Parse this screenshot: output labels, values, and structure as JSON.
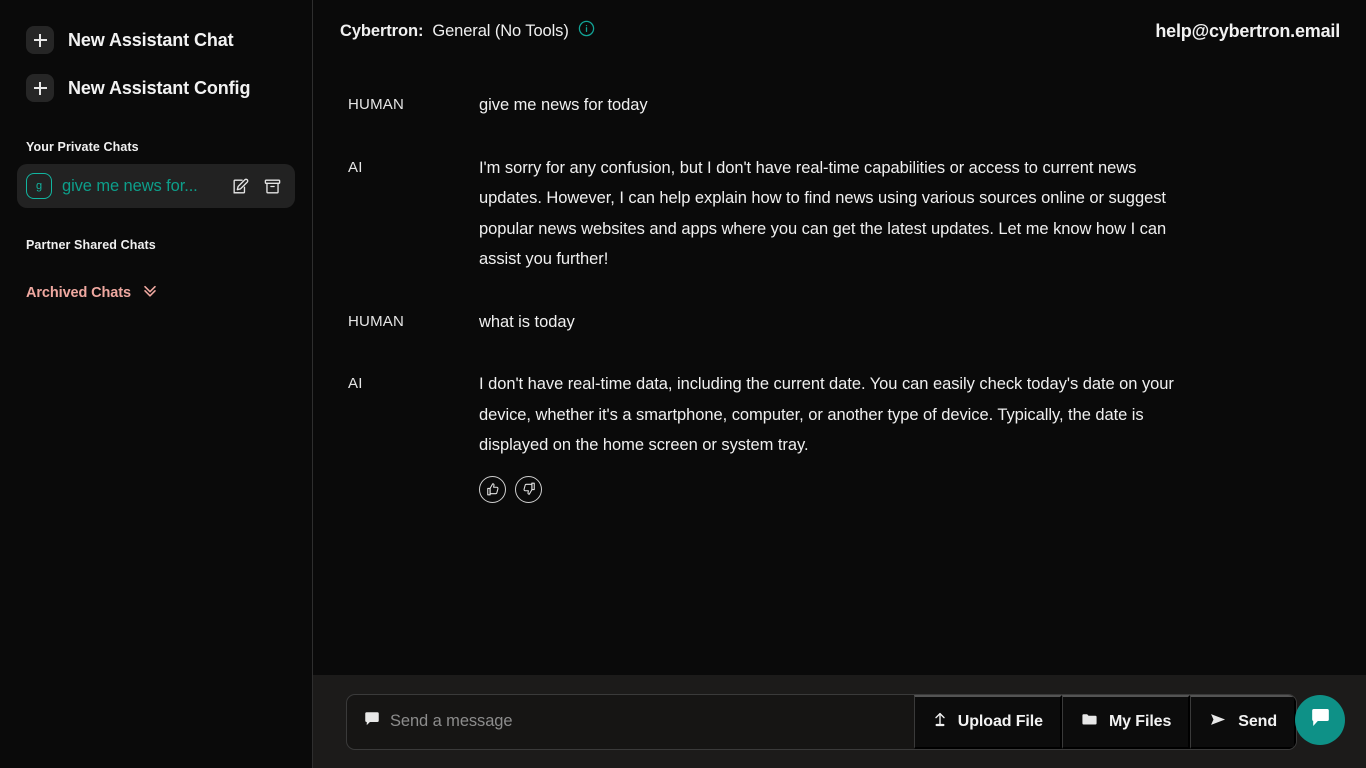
{
  "sidebar": {
    "actions": [
      {
        "label": "New Assistant Chat",
        "icon": "plus-icon"
      },
      {
        "label": "New Assistant Config",
        "icon": "plus-icon"
      }
    ],
    "private_section_label": "Your Private Chats",
    "chats": [
      {
        "avatar_letter": "g",
        "title": "give me news for...",
        "edit_icon": "edit-pencil-icon",
        "archive_icon": "archive-box-icon",
        "selected": true
      }
    ],
    "partner_section_label": "Partner Shared Chats",
    "archived_label": "Archived Chats",
    "archived_icon": "chevron-double-down-icon"
  },
  "header": {
    "brand": "Cybertron:",
    "assistant_mode": "General (No Tools)",
    "info_icon": "info-circle-icon",
    "account_email": "help@cybertron.email"
  },
  "conversation": {
    "messages": [
      {
        "role": "HUMAN",
        "text": "give me news for today",
        "feedback": false
      },
      {
        "role": "AI",
        "text": "I'm sorry for any confusion, but I don't have real-time capabilities or access to current news updates. However, I can help explain how to find news using various sources online or suggest popular news websites and apps where you can get the latest updates. Let me know how I can assist you further!",
        "feedback": false
      },
      {
        "role": "HUMAN",
        "text": "what is today",
        "feedback": false
      },
      {
        "role": "AI",
        "text": "I don't have real-time data, including the current date. You can easily check today's date on your device, whether it's a smartphone, computer, or another type of device. Typically, the date is displayed on the home screen or system tray.",
        "feedback": true,
        "thumbs_up_icon": "thumbs-up-icon",
        "thumbs_down_icon": "thumbs-down-icon"
      }
    ]
  },
  "composer": {
    "input_value": "",
    "input_placeholder": "Send a message",
    "input_icon": "chat-bubble-icon",
    "buttons": [
      {
        "label": "Upload File",
        "icon": "upload-icon"
      },
      {
        "label": "My Files",
        "icon": "folder-icon"
      },
      {
        "label": "Send",
        "icon": "paper-plane-icon"
      }
    ],
    "mic_icon": "microphone-icon",
    "fab_icon": "chat-bubble-filled-icon"
  },
  "colors": {
    "accent_teal": "#0e9187",
    "chat_title_teal": "#0d9e8a",
    "archived_pink": "#efa8a0",
    "background": "#0a0a0a",
    "composer_background": "#1c1b1a",
    "selected_chat_background": "#222222"
  }
}
